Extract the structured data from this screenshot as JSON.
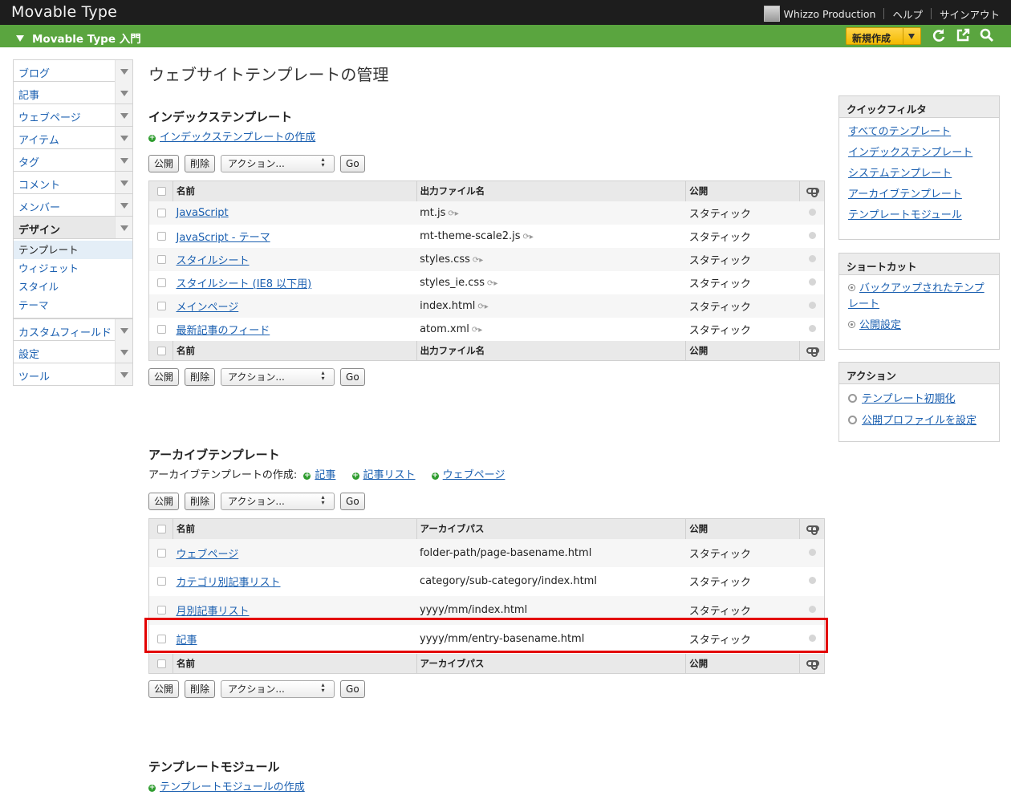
{
  "topbar": {
    "logo": "Movable Type",
    "user": "Whizzo Production",
    "help": "ヘルプ",
    "signout": "サインアウト"
  },
  "sitebar": {
    "site_name": "Movable Type 入門",
    "new_button": "新規作成",
    "icons": [
      "refresh-icon",
      "view-site-icon",
      "search-icon"
    ]
  },
  "leftnav": {
    "groups": [
      {
        "label": "ブログ"
      },
      {
        "label": "記事"
      },
      {
        "label": "ウェブページ"
      },
      {
        "label": "アイテム"
      },
      {
        "label": "タグ"
      },
      {
        "label": "コメント"
      },
      {
        "label": "メンバー"
      },
      {
        "label": "デザイン"
      }
    ],
    "design_sub": [
      "テンプレート",
      "ウィジェット",
      "スタイル",
      "テーマ"
    ],
    "groups_after": [
      {
        "label": "カスタムフィールド"
      },
      {
        "label": "設定"
      },
      {
        "label": "ツール"
      }
    ]
  },
  "page_title": "ウェブサイトテンプレートの管理",
  "buttons": {
    "publish": "公開",
    "delete": "削除",
    "action": "アクション...",
    "go": "Go"
  },
  "index_section": {
    "title": "インデックステンプレート",
    "create_link": "インデックステンプレートの作成",
    "columns": [
      "名前",
      "出力ファイル名",
      "公開"
    ],
    "rows": [
      {
        "name": "JavaScript",
        "output": "mt.js",
        "publish": "スタティック"
      },
      {
        "name": "JavaScript - テーマ",
        "output": "mt-theme-scale2.js",
        "publish": "スタティック"
      },
      {
        "name": "スタイルシート",
        "output": "styles.css",
        "publish": "スタティック"
      },
      {
        "name": "スタイルシート (IE8 以下用)",
        "output": "styles_ie.css",
        "publish": "スタティック"
      },
      {
        "name": "メインページ",
        "output": "index.html",
        "publish": "スタティック"
      },
      {
        "name": "最新記事のフィード",
        "output": "atom.xml",
        "publish": "スタティック"
      }
    ]
  },
  "archive_section": {
    "title": "アーカイブテンプレート",
    "create_prefix": "アーカイブテンプレートの作成:",
    "create_links": [
      "記事",
      "記事リスト",
      "ウェブページ"
    ],
    "columns": [
      "名前",
      "アーカイブパス",
      "公開"
    ],
    "rows": [
      {
        "name": "ウェブページ",
        "path": "folder-path/page-basename.html",
        "publish": "スタティック"
      },
      {
        "name": "カテゴリ別記事リスト",
        "path": "category/sub-category/index.html",
        "publish": "スタティック"
      },
      {
        "name": "月別記事リスト",
        "path": "yyyy/mm/index.html",
        "publish": "スタティック"
      },
      {
        "name": "記事",
        "path": "yyyy/mm/entry-basename.html",
        "publish": "スタティック"
      }
    ]
  },
  "module_section": {
    "title": "テンプレートモジュール",
    "create_link": "テンプレートモジュールの作成"
  },
  "quickfilter": {
    "title": "クイックフィルタ",
    "items": [
      "すべてのテンプレート",
      "インデックステンプレート",
      "システムテンプレート",
      "アーカイブテンプレート",
      "テンプレートモジュール"
    ]
  },
  "shortcut": {
    "title": "ショートカット",
    "items": [
      "バックアップされたテンプレート",
      "公開設定"
    ]
  },
  "actions": {
    "title": "アクション",
    "items": [
      "テンプレート初期化",
      "公開プロファイルを設定"
    ]
  },
  "colors": {
    "topbar": "#1d1d1d",
    "sitebar": "#5aa53f",
    "new_button": "#f3b900",
    "link": "#1a5fb0",
    "highlight": "#e30000"
  }
}
